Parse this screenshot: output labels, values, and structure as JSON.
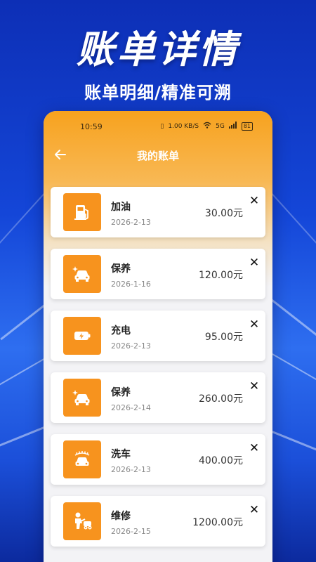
{
  "promo": {
    "headline": "账单详情",
    "subline": "账单明细/精准可溯"
  },
  "status_bar": {
    "time": "10:59",
    "network_speed": "1.00 KB/S",
    "signal": "5G",
    "battery": "81"
  },
  "header": {
    "title": "我的账单",
    "back_icon": "arrow-left-icon"
  },
  "colors": {
    "accent": "#f7931e",
    "header_gradient_top": "#f7a21e"
  },
  "bills": [
    {
      "name": "加油",
      "date": "2026-2-13",
      "amount": "30.00元",
      "icon": "fuel-pump-icon"
    },
    {
      "name": "保养",
      "date": "2026-1-16",
      "amount": "120.00元",
      "icon": "car-sparkle-icon"
    },
    {
      "name": "充电",
      "date": "2026-2-13",
      "amount": "95.00元",
      "icon": "battery-charge-icon"
    },
    {
      "name": "保养",
      "date": "2026-2-14",
      "amount": "260.00元",
      "icon": "car-sparkle-icon"
    },
    {
      "name": "洗车",
      "date": "2026-2-13",
      "amount": "400.00元",
      "icon": "car-wash-icon"
    },
    {
      "name": "维修",
      "date": "2026-2-15",
      "amount": "1200.00元",
      "icon": "mechanic-icon"
    }
  ],
  "close_glyph": "✕"
}
